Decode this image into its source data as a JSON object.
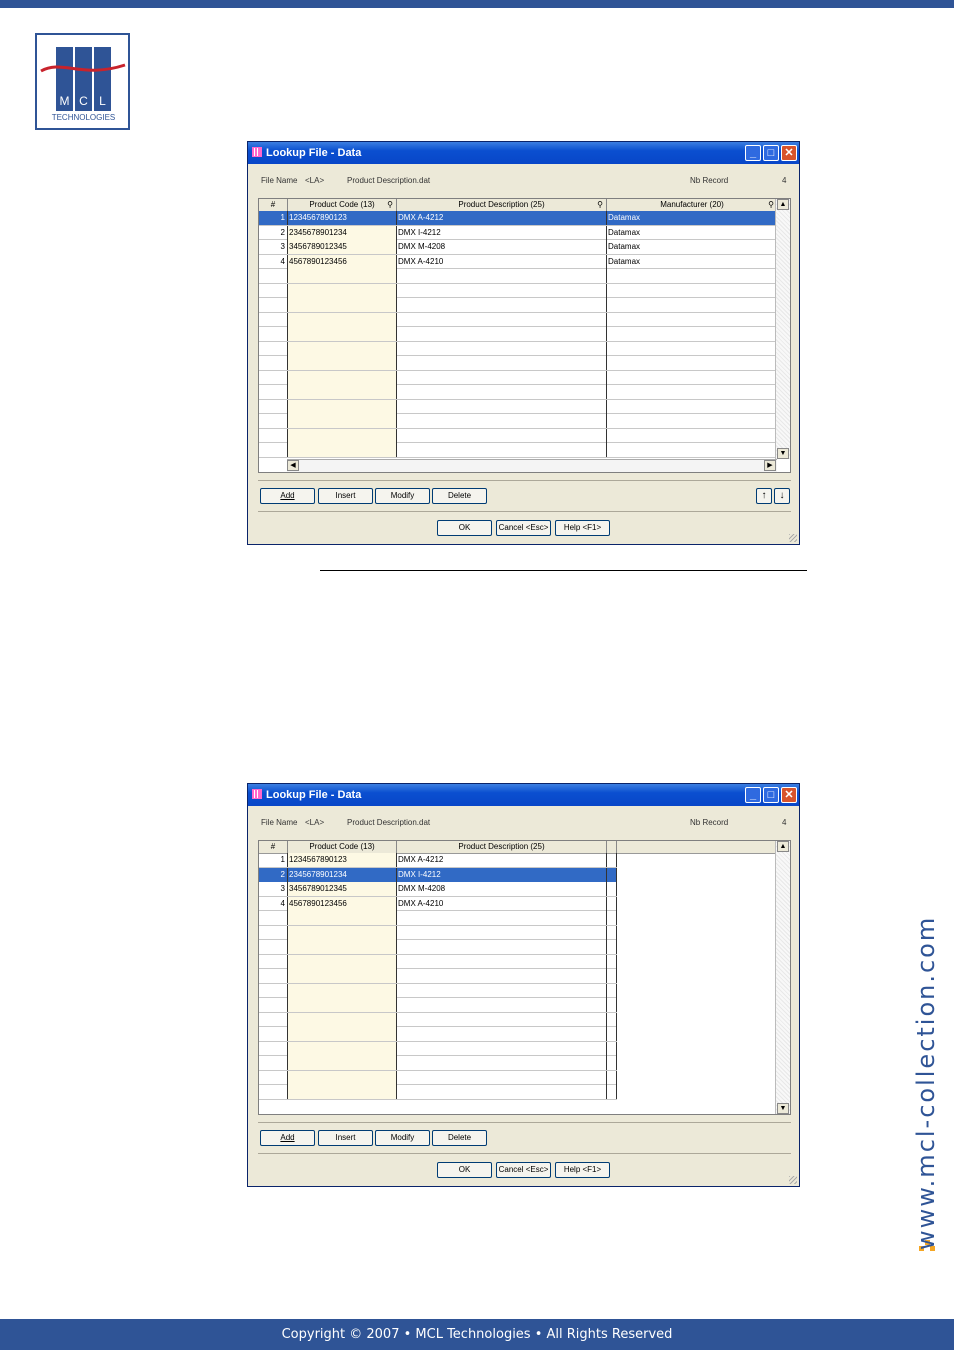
{
  "header": {
    "logo_letters": [
      "M",
      "C",
      "L"
    ],
    "logo_sub": "TECHNOLOGIES"
  },
  "sidebar": {
    "url": "www.mcl-collection.com"
  },
  "footer": {
    "text": "Copyright © 2007 • MCL Technologies • All Rights Reserved"
  },
  "colors": {
    "brand": "#2f5496",
    "titlebar": "#0a4fd0",
    "selection": "#316ac5",
    "code_column": "#fdf9e4"
  },
  "dialog1": {
    "title": "Lookup File - Data",
    "file_name_label": "File Name",
    "file_tag": "<LA>",
    "file_name": "Product Description.dat",
    "nb_record_label": "Nb Record",
    "nb_record": "4",
    "columns": [
      "#",
      "Product Code (13)",
      "Product Description (25)",
      "Manufacturer (20)"
    ],
    "rows": [
      {
        "n": "1",
        "code": "1234567890123",
        "desc": "DMX A-4212",
        "mfr": "Datamax"
      },
      {
        "n": "2",
        "code": "2345678901234",
        "desc": "DMX I-4212",
        "mfr": "Datamax"
      },
      {
        "n": "3",
        "code": "3456789012345",
        "desc": "DMX M-4208",
        "mfr": "Datamax"
      },
      {
        "n": "4",
        "code": "4567890123456",
        "desc": "DMX A-4210",
        "mfr": "Datamax"
      }
    ],
    "selected_row": 1,
    "buttons": {
      "add": "Add",
      "insert": "Insert",
      "modify": "Modify",
      "delete": "Delete",
      "ok": "OK",
      "cancel": "Cancel <Esc>",
      "help": "Help <F1>"
    }
  },
  "dialog2": {
    "title": "Lookup File - Data",
    "file_name_label": "File Name",
    "file_tag": "<LA>",
    "file_name": "Product Description.dat",
    "nb_record_label": "Nb Record",
    "nb_record": "4",
    "columns": [
      "#",
      "Product Code (13)",
      "Product Description (25)"
    ],
    "rows": [
      {
        "n": "1",
        "code": "1234567890123",
        "desc": "DMX A-4212"
      },
      {
        "n": "2",
        "code": "2345678901234",
        "desc": "DMX I-4212"
      },
      {
        "n": "3",
        "code": "3456789012345",
        "desc": "DMX M-4208"
      },
      {
        "n": "4",
        "code": "4567890123456",
        "desc": "DMX A-4210"
      }
    ],
    "selected_row": 2,
    "buttons": {
      "add": "Add",
      "insert": "Insert",
      "modify": "Modify",
      "delete": "Delete",
      "ok": "OK",
      "cancel": "Cancel <Esc>",
      "help": "Help <F1>"
    }
  }
}
